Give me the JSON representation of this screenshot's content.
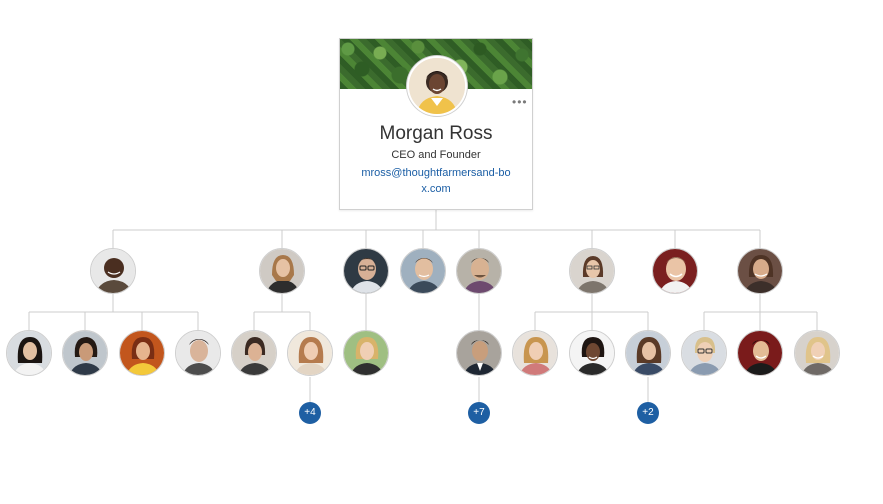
{
  "ceo": {
    "name": "Morgan Ross",
    "title": "CEO and Founder",
    "email": "mross@thoughtfarmersand-box.com",
    "more_icon": "more-horizontal-icon"
  },
  "colors": {
    "link": "#1b5ea5",
    "badge": "#1e5fa3",
    "connector": "#cccccc"
  },
  "badges": {
    "group_a": "+4",
    "group_b": "+7",
    "group_c": "+2"
  }
}
